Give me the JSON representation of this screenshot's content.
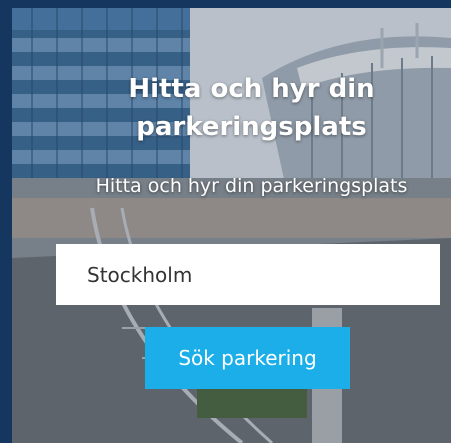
{
  "hero": {
    "title": "Hitta och hyr din parkeringsplats",
    "subtitle": "Hitta och hyr din parkeringsplats"
  },
  "search": {
    "value": "Stockholm"
  },
  "actions": {
    "search_label": "Sök parkering"
  },
  "colors": {
    "frame": "#15375f",
    "button": "#1baee8"
  }
}
